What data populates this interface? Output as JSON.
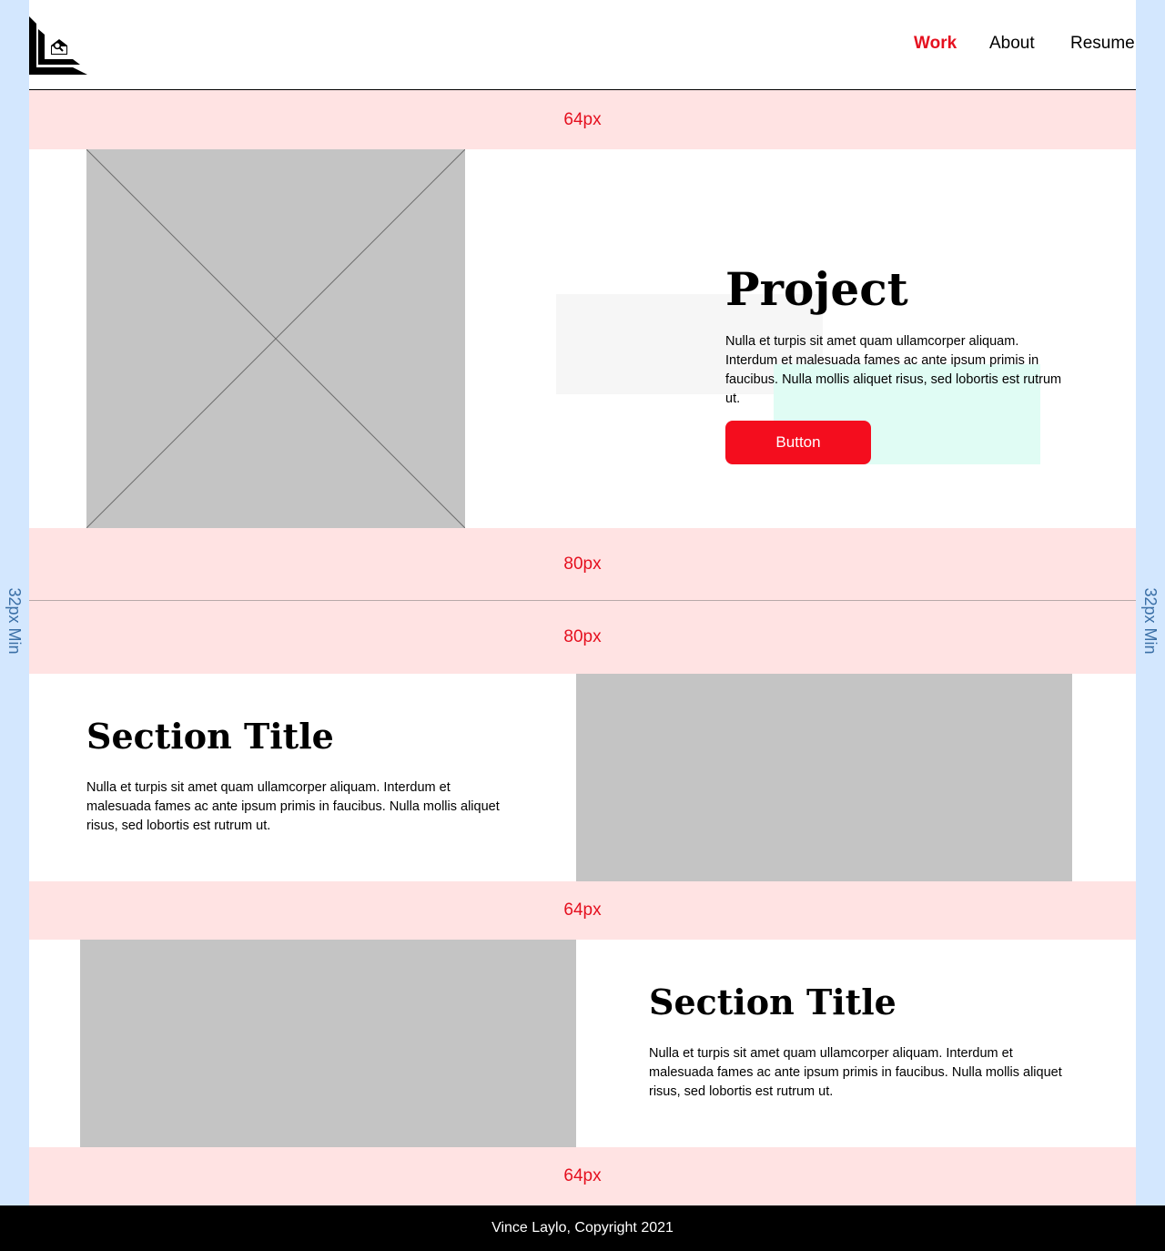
{
  "margins": {
    "left_label": "32px Min",
    "right_label": "32px Min"
  },
  "nav": {
    "items": [
      {
        "label": "Work",
        "active": true
      },
      {
        "label": "About",
        "active": false
      },
      {
        "label": "Resume",
        "active": false
      }
    ]
  },
  "spacers": [
    "64px",
    "80px",
    "80px",
    "64px",
    "64px"
  ],
  "hero": {
    "title": "Project",
    "body": "Nulla et turpis sit amet quam ullamcorper aliquam. Interdum et malesuada fames ac ante ipsum primis in faucibus. Nulla mollis aliquet risus, sed lobortis est rutrum ut.",
    "button_label": "Button"
  },
  "sections": [
    {
      "title": "Section Title",
      "body": "Nulla et turpis sit amet quam ullamcorper aliquam. Interdum et malesuada fames ac ante ipsum primis in faucibus. Nulla mollis aliquet risus, sed lobortis est rutrum ut."
    },
    {
      "title": "Section Title",
      "body": "Nulla et turpis sit amet quam ullamcorper aliquam. Interdum et malesuada fames ac ante ipsum primis in faucibus. Nulla mollis aliquet risus, sed lobortis est rutrum ut."
    }
  ],
  "footer": {
    "text": "Vince Laylo, Copyright 2021"
  },
  "colors": {
    "accent": "#e5101f",
    "button": "#f40d1e",
    "spacer_bg": "#ffe3e3",
    "margin_bg": "#d3e7fe",
    "placeholder": "#c4c4c4"
  }
}
